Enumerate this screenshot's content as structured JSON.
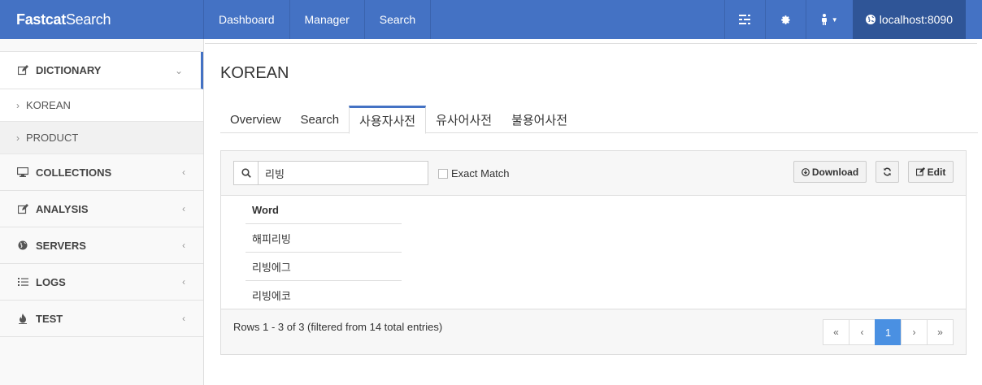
{
  "brand": {
    "bold": "Fastcat",
    "light": "Search"
  },
  "nav": {
    "items": [
      "Dashboard",
      "Manager",
      "Search"
    ],
    "host": "localhost:8090"
  },
  "icons": {
    "list": "list-icon",
    "settings": "gear-icon",
    "user": "user-icon",
    "globe": "globe-icon"
  },
  "sidebar": {
    "menus": [
      {
        "label": "DICTIONARY",
        "icon": "edit-icon",
        "open": true
      },
      {
        "label": "COLLECTIONS",
        "icon": "monitor-icon"
      },
      {
        "label": "ANALYSIS",
        "icon": "edit-icon"
      },
      {
        "label": "SERVERS",
        "icon": "globe-icon"
      },
      {
        "label": "LOGS",
        "icon": "list-icon"
      },
      {
        "label": "TEST",
        "icon": "fire-icon"
      }
    ],
    "submenu": [
      "KOREAN",
      "PRODUCT"
    ]
  },
  "main": {
    "title": "KOREAN",
    "tabs": [
      "Overview",
      "Search",
      "사용자사전",
      "유사어사전",
      "불용어사전"
    ],
    "active_tab": 2,
    "search": {
      "value": "리빙",
      "exact_match_label": "Exact Match",
      "exact_match_checked": false
    },
    "buttons": {
      "download": "Download",
      "edit": "Edit"
    },
    "table": {
      "header": "Word",
      "rows": [
        "해피리빙",
        "리빙에그",
        "리빙에코"
      ]
    },
    "footer": {
      "rows_info": "Rows 1 - 3 of 3 (filtered from 14 total entries)"
    },
    "pagination": {
      "first": "«",
      "prev": "‹",
      "current": "1",
      "next": "›",
      "last": "»"
    }
  },
  "colors": {
    "navbar": "#4472c4",
    "host_bg": "#2f5597",
    "active_page": "#4a90e2"
  }
}
